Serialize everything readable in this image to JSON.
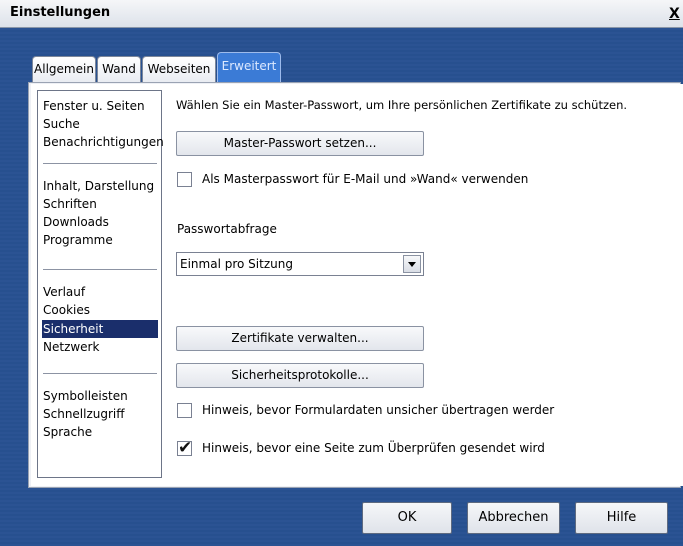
{
  "window": {
    "title": "Einstellungen",
    "close_label": "X"
  },
  "tabs": [
    {
      "label": "Allgemein"
    },
    {
      "label": "Wand"
    },
    {
      "label": "Webseiten"
    },
    {
      "label": "Erweitert",
      "active": true
    }
  ],
  "sidebar": {
    "items": [
      {
        "label": "Fenster u. Seiten"
      },
      {
        "label": "Suche"
      },
      {
        "label": "Benachrichtigungen"
      },
      {
        "label": "Inhalt, Darstellung"
      },
      {
        "label": "Schriften"
      },
      {
        "label": "Downloads"
      },
      {
        "label": "Programme"
      },
      {
        "label": "Verlauf"
      },
      {
        "label": "Cookies"
      },
      {
        "label": "Sicherheit",
        "selected": true
      },
      {
        "label": "Netzwerk"
      },
      {
        "label": "Symbolleisten"
      },
      {
        "label": "Schnellzugriff"
      },
      {
        "label": "Sprache"
      }
    ]
  },
  "security": {
    "intro": "Wählen Sie ein Master-Passwort, um Ihre persönlichen Zertifikate zu schützen.",
    "set_master_button": "Master-Passwort setzen...",
    "use_master_checkbox": {
      "label": "Als Masterpasswort für E-Mail und »Wand« verwenden",
      "checked": false
    },
    "password_prompt_label": "Passwortabfrage",
    "password_prompt_select": {
      "value": "Einmal pro Sitzung"
    },
    "manage_certs_button": "Zertifikate verwalten...",
    "security_protocols_button": "Sicherheitsprotokolle...",
    "warn_insecure_form_checkbox": {
      "label": "Hinweis, bevor Formulardaten unsicher übertragen werder",
      "checked": false
    },
    "warn_page_check_checkbox": {
      "label": "Hinweis, bevor eine Seite zum Überprüfen gesendet wird",
      "checked": true
    }
  },
  "footer": {
    "ok": "OK",
    "cancel": "Abbrechen",
    "help": "Hilfe"
  }
}
